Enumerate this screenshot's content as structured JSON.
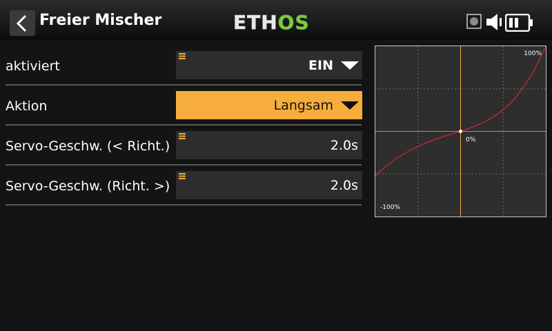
{
  "header": {
    "title": "Freier Mischer",
    "logo_text": "ETHOS",
    "icons": [
      "back-arrow-icon",
      "record-icon",
      "speaker-icon",
      "battery-icon"
    ],
    "accent_color": "#f7ad3b",
    "logo_accent_color": "#7ac943"
  },
  "rows": [
    {
      "label": "aktiviert",
      "value": "EIN"
    },
    {
      "label": "Aktion",
      "value": "Langsam"
    },
    {
      "label": "Servo-Geschw. (< Richt.)",
      "value": "2.0s"
    },
    {
      "label": "Servo-Geschw. (Richt. >)",
      "value": "2.0s"
    }
  ],
  "graph": {
    "label_top": "100%",
    "label_center": "0%",
    "label_bottom": "-100%",
    "curve_color": "#d42a2a",
    "cursor_color": "#f7ad3b",
    "cursor_value_percent": 0
  }
}
